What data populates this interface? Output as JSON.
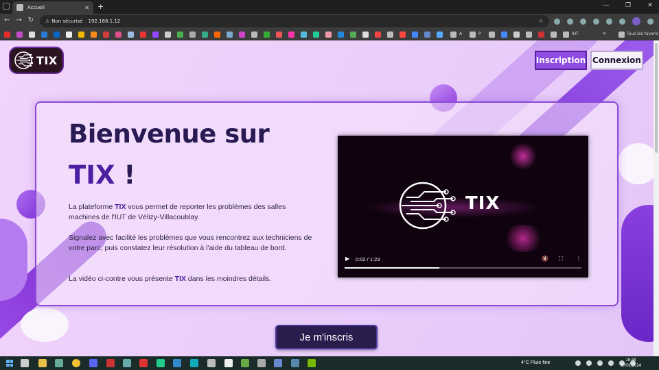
{
  "browser": {
    "tab_title": "Accueil",
    "tab_close": "✕",
    "new_tab": "+",
    "window_buttons": [
      "—",
      "❐",
      "✕"
    ],
    "nav": {
      "back": "←",
      "forward": "→",
      "reload": "↻"
    },
    "security_label": "Non sécurisé",
    "url": "192.168.1.12",
    "bookmarks_visible_text": [
      "A",
      "P",
      "IUT"
    ],
    "bookmarks_overflow": "»",
    "all_bookmarks": "Tous les favoris"
  },
  "header": {
    "logo_text": "TIX",
    "signup_label": "Inscription",
    "login_label": "Connexion"
  },
  "hero": {
    "title_line1": "Bienvenue sur",
    "title_accent": "TIX",
    "title_suffix": " !",
    "p1_before": "La plateforme ",
    "p1_brand": "TIX",
    "p1_after": " vous permet de reporter les problèmes des salles machines de l'IUT de Vélizy-Villacoublay.",
    "p2": "Signalez avec facilité les problèmes que vous rencontrez aux techniciens de votre parc, puis constatez leur résolution à l'aide du tableau de bord.",
    "p3_before": "La vidéo ci-contre vous présente ",
    "p3_brand": "TIX",
    "p3_after": " dans les moindres détails."
  },
  "video": {
    "brand_text": "TIX",
    "time": "0:02 / 1:23",
    "progress_fraction": 0.4
  },
  "cta": {
    "label": "Je m'inscris"
  },
  "taskbar": {
    "weather": "4°C  Pluie fine",
    "time": "16:44",
    "date": "17/01/2024"
  },
  "colors": {
    "accent": "#8f4ce0",
    "title": "#281a52",
    "brand": "#4b1fa0",
    "cta_bg": "#2a1d4e"
  }
}
